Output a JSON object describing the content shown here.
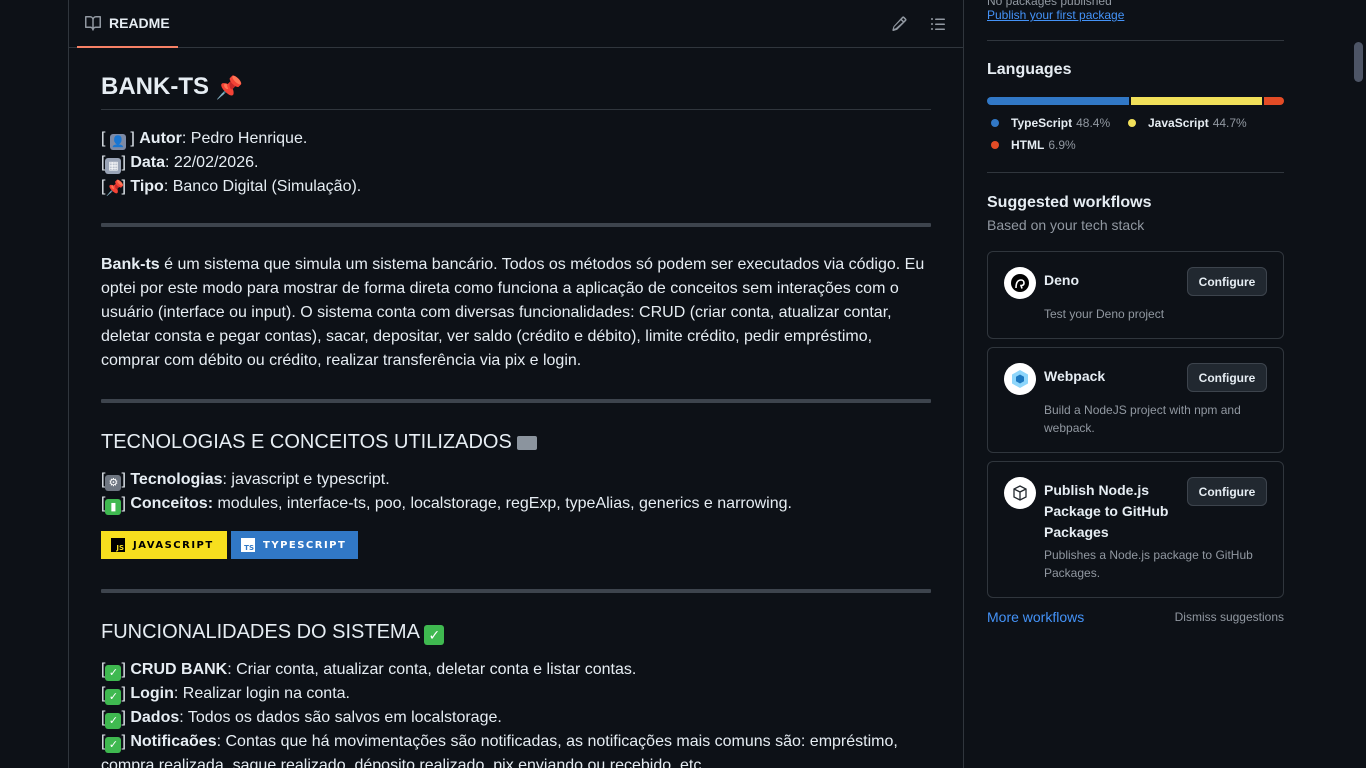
{
  "readme": {
    "tab_label": "README",
    "title": "BANK-TS",
    "meta": [
      {
        "label": "Autor",
        "value": ": Pedro Henrique."
      },
      {
        "label": "Data",
        "value": ": 22/02/2026."
      },
      {
        "label": "Tipo",
        "value": ": Banco Digital (Simulação)."
      }
    ],
    "intro_bold": "Bank-ts",
    "intro_text": " é um sistema que simula um sistema bancário. Todos os métodos só podem ser executados via código. Eu optei por este modo para mostrar de forma direta como funciona a aplicação de conceitos sem interações com o usuário (interface ou input). O sistema conta com diversas funcionalidades: CRUD (criar conta, atualizar contar, deletar consta e pegar contas), sacar, depositar, ver saldo (crédito e débito), limite crédito, pedir empréstimo, comprar com débito ou crédito, realizar transferência via pix e login.",
    "tech_heading": "TECNOLOGIAS E CONCEITOS UTILIZADOS",
    "tech": [
      {
        "label": "Tecnologias",
        "value": ": javascript e typescript."
      },
      {
        "label": "Conceitos:",
        "value": " modules, interface-ts, poo, localstorage, regExp, typeAlias, generics e narrowing."
      }
    ],
    "badges": {
      "js": "JAVASCRIPT",
      "js_logo": "JS",
      "ts": "TYPESCRIPT",
      "ts_logo": "TS"
    },
    "features_heading": "FUNCIONALIDADES DO SISTEMA",
    "features": [
      {
        "label": "CRUD BANK",
        "value": ": Criar conta, atualizar conta, deletar conta e listar contas."
      },
      {
        "label": "Login",
        "value": ": Realizar login na conta."
      },
      {
        "label": "Dados",
        "value": ": Todos os dados são salvos em localstorage."
      },
      {
        "label": "Notificaões",
        "value": ": Contas que há movimentações são notificadas, as notificações mais comuns são: empréstimo, compra realizada, saque realizado, déposito realizado, pix enviando ou recebido, etc."
      }
    ]
  },
  "sidebar": {
    "packages_text": "No packages published",
    "packages_link": "Publish your first package",
    "languages_heading": "Languages",
    "languages": [
      {
        "name": "TypeScript",
        "percent": "48.4%",
        "share": 48.4,
        "color": "#3178c6"
      },
      {
        "name": "JavaScript",
        "percent": "44.7%",
        "share": 44.7,
        "color": "#f1e05a"
      },
      {
        "name": "HTML",
        "percent": "6.9%",
        "share": 6.9,
        "color": "#e34c26"
      }
    ],
    "workflows_heading": "Suggested workflows",
    "workflows_sub": "Based on your tech stack",
    "workflows": [
      {
        "title": "Deno",
        "desc": "Test your Deno project",
        "button": "Configure",
        "icon": "deno-icon"
      },
      {
        "title": "Webpack",
        "desc": "Build a NodeJS project with npm and webpack.",
        "button": "Configure",
        "icon": "webpack-icon"
      },
      {
        "title": "Publish Node.js Package to GitHub Packages",
        "desc": "Publishes a Node.js package to GitHub Packages.",
        "button": "Configure",
        "icon": "package-icon"
      }
    ],
    "more_workflows": "More workflows",
    "dismiss": "Dismiss suggestions"
  }
}
